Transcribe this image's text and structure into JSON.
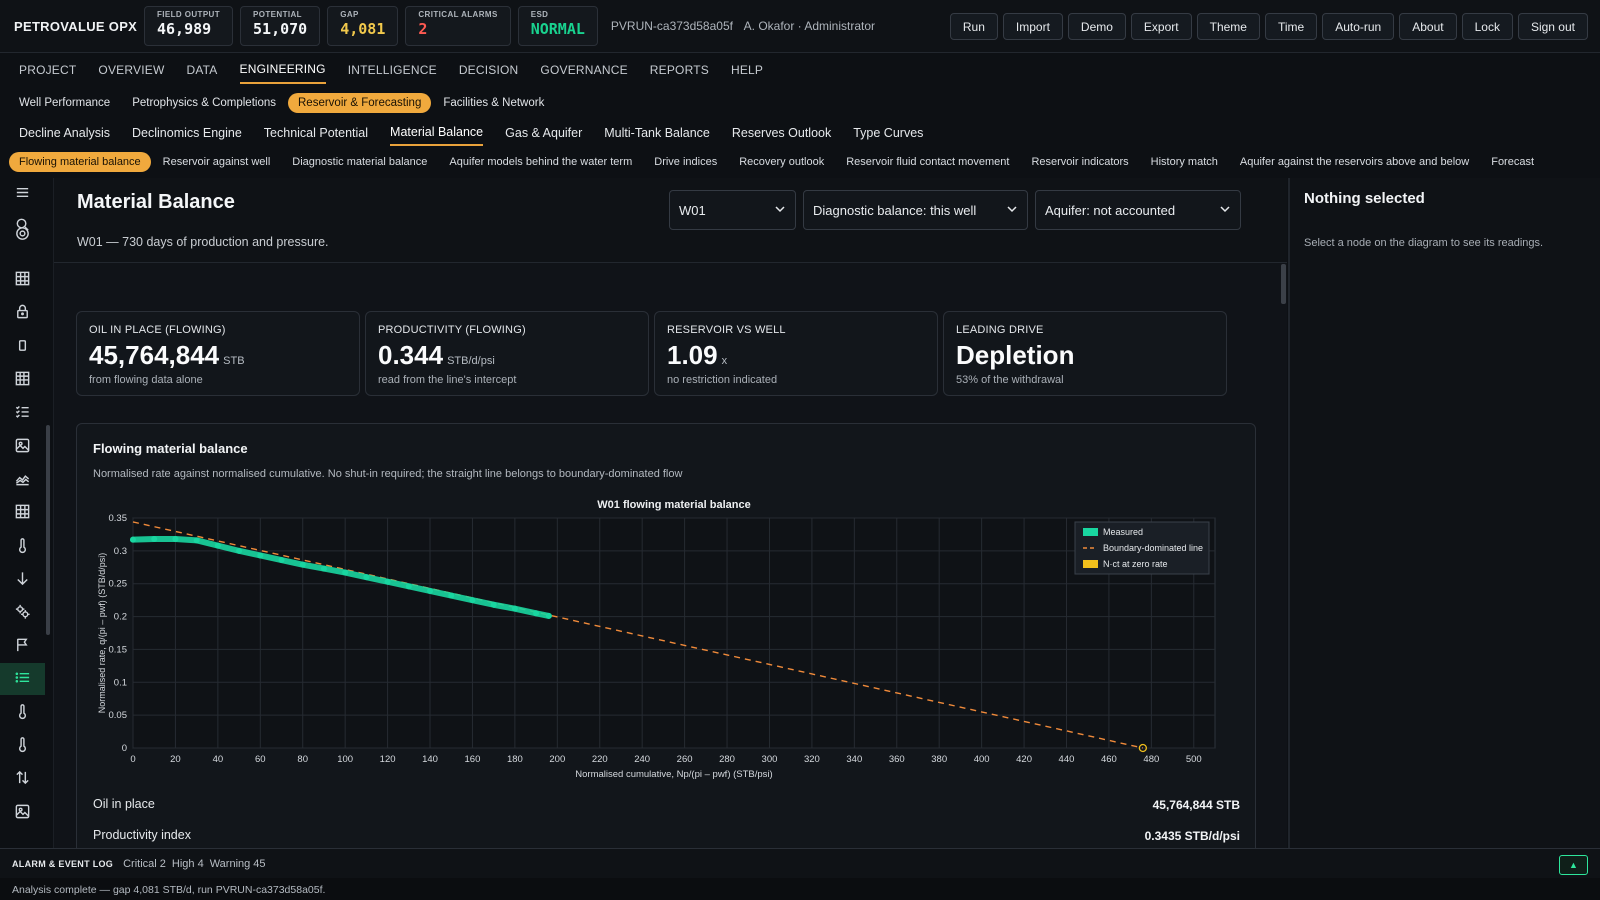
{
  "brand": "PETROVALUE OPX",
  "kpis": [
    {
      "label": "FIELD OUTPUT",
      "value": "46,989",
      "tone": ""
    },
    {
      "label": "POTENTIAL",
      "value": "51,070",
      "tone": ""
    },
    {
      "label": "GAP",
      "value": "4,081",
      "tone": "yellow"
    },
    {
      "label": "CRITICAL ALARMS",
      "value": "2",
      "tone": "red"
    },
    {
      "label": "ESD",
      "value": "NORMAL",
      "tone": "green"
    }
  ],
  "run_id": "PVRUN-ca373d58a05f",
  "user": "A. Okafor · Administrator",
  "top_buttons": [
    "Run",
    "Import",
    "Demo",
    "Export",
    "Theme",
    "Time",
    "Auto-run",
    "About",
    "Lock",
    "Sign out"
  ],
  "main_nav": [
    "PROJECT",
    "OVERVIEW",
    "DATA",
    "ENGINEERING",
    "INTELLIGENCE",
    "DECISION",
    "GOVERNANCE",
    "REPORTS",
    "HELP"
  ],
  "main_nav_active": 3,
  "sub_nav": [
    "Well Performance",
    "Petrophysics & Completions",
    "Reservoir & Forecasting",
    "Facilities & Network"
  ],
  "sub_nav_active": 2,
  "tab_nav": [
    "Decline Analysis",
    "Declinomics Engine",
    "Technical Potential",
    "Material Balance",
    "Gas & Aquifer",
    "Multi-Tank Balance",
    "Reserves Outlook",
    "Type Curves"
  ],
  "tab_nav_active": 3,
  "pill_nav": [
    "Flowing material balance",
    "Reservoir against well",
    "Diagnostic material balance",
    "Aquifer models behind the water term",
    "Drive indices",
    "Recovery outlook",
    "Reservoir fluid contact movement",
    "Reservoir indicators",
    "History match",
    "Aquifer against the reservoirs above and below",
    "Forecast"
  ],
  "pill_nav_active": 0,
  "sidebar_icons": [
    "menu-icon",
    "search-icon",
    "target-icon",
    "grid-icon",
    "lock-icon",
    "phone-icon",
    "table-icon",
    "checklist-icon",
    "image-icon",
    "area-chart-icon",
    "grid-icon",
    "thermometer-icon",
    "arrow-down-icon",
    "gears-icon",
    "flag-icon",
    "list-icon",
    "thermometer-icon",
    "thermometer-icon",
    "swap-vertical-icon",
    "image-icon"
  ],
  "sidebar_active": 15,
  "page": {
    "title": "Material Balance",
    "subtitle": "W01 — 730 days of production and pressure.",
    "selects": [
      "W01",
      "Diagnostic balance: this well",
      "Aquifer: not accounted"
    ]
  },
  "cards": [
    {
      "label": "OIL IN PLACE (FLOWING)",
      "value": "45,764,844",
      "unit": "STB",
      "sub": "from flowing data alone"
    },
    {
      "label": "PRODUCTIVITY (FLOWING)",
      "value": "0.344",
      "unit": "STB/d/psi",
      "sub": "read from the line's intercept"
    },
    {
      "label": "RESERVOIR VS WELL",
      "value": "1.09",
      "unit": "x",
      "sub": "no restriction indicated"
    },
    {
      "label": "LEADING DRIVE",
      "value": "Depletion",
      "unit": "",
      "sub": "53% of the withdrawal"
    }
  ],
  "chart_card": {
    "title": "Flowing material balance",
    "subtitle": "Normalised rate against normalised cumulative. No shut-in required; the straight line belongs to boundary-dominated flow"
  },
  "chart_data": {
    "type": "scatter",
    "title": "W01 flowing material balance",
    "xlabel": "Normalised cumulative, Np/(pi – pwf)  (STB/psi)",
    "ylabel": "Normalised rate, q/(pi – pwf)  (STB/d/psi)",
    "xlim": [
      0,
      510
    ],
    "ylim": [
      0,
      0.35
    ],
    "xticks": [
      0,
      20,
      40,
      60,
      80,
      100,
      120,
      140,
      160,
      180,
      200,
      220,
      240,
      260,
      280,
      300,
      320,
      340,
      360,
      380,
      400,
      420,
      440,
      460,
      480,
      500
    ],
    "yticks": [
      0,
      0.05,
      0.1,
      0.15,
      0.2,
      0.25,
      0.3,
      0.35
    ],
    "legend_position": "top-right",
    "series": [
      {
        "name": "Measured",
        "kind": "scatter",
        "color": "#19d6a0",
        "x": [
          0,
          10,
          20,
          30,
          40,
          50,
          60,
          70,
          80,
          90,
          100,
          110,
          120,
          130,
          140,
          150,
          160,
          170,
          180,
          190,
          196
        ],
        "y": [
          0.317,
          0.318,
          0.318,
          0.316,
          0.308,
          0.3,
          0.293,
          0.286,
          0.279,
          0.273,
          0.267,
          0.26,
          0.253,
          0.246,
          0.239,
          0.232,
          0.225,
          0.218,
          0.212,
          0.205,
          0.201
        ]
      },
      {
        "name": "Boundary-dominated line",
        "kind": "line",
        "color": "#f08a3a",
        "x": [
          0,
          476
        ],
        "y": [
          0.344,
          0
        ]
      },
      {
        "name": "N·ct at zero rate",
        "kind": "marker",
        "color": "#f2c01c",
        "x": [
          476
        ],
        "y": [
          0
        ]
      }
    ]
  },
  "facts": [
    {
      "label": "Oil in place",
      "value": "45,764,844 STB"
    },
    {
      "label": "Productivity index",
      "value": "0.3435 STB/d/psi"
    }
  ],
  "right_panel": {
    "title": "Nothing selected",
    "hint": "Select a node on the diagram to see its readings."
  },
  "alarm_log": {
    "title": "ALARM & EVENT LOG",
    "stats": [
      "Critical 2",
      "High 4",
      "Warning 45"
    ],
    "toggle": "▲"
  },
  "status": "Analysis complete — gap 4,081 STB/d, run PVRUN-ca373d58a05f."
}
